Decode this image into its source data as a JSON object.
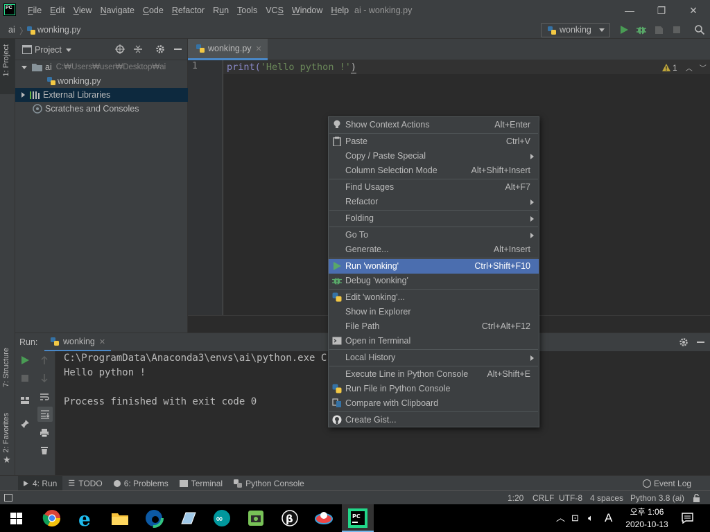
{
  "window": {
    "title": "ai - wonking.py",
    "logo_text": "PC",
    "menu": [
      {
        "label": "File",
        "u": "F"
      },
      {
        "label": "Edit",
        "u": "E"
      },
      {
        "label": "View",
        "u": "V"
      },
      {
        "label": "Navigate",
        "u": "N"
      },
      {
        "label": "Code",
        "u": "C"
      },
      {
        "label": "Refactor",
        "u": "R"
      },
      {
        "label": "Run",
        "u": "u"
      },
      {
        "label": "Tools",
        "u": "T"
      },
      {
        "label": "VCS",
        "u": "S"
      },
      {
        "label": "Window",
        "u": "W"
      },
      {
        "label": "Help",
        "u": "H"
      }
    ],
    "minimize": "—",
    "restore": "❐",
    "close": "✕"
  },
  "navbar": {
    "project": "ai",
    "separator": "〉",
    "file": "wonking.py",
    "run_config": "wonking"
  },
  "left_strip": {
    "project_tab": "1: Project",
    "structure_tab": "7: Structure",
    "favorites_tab": "2: Favorites"
  },
  "project_panel": {
    "title": "Project",
    "tree": {
      "root_name": "ai",
      "root_path": "C:₩Users₩user₩Desktop₩ai",
      "file": "wonking.py",
      "ext_libs": "External Libraries",
      "scratches": "Scratches and Consoles"
    }
  },
  "editor": {
    "tab": "wonking.py",
    "line_number": "1",
    "code_func": "print(",
    "code_string": "'Hello python !'",
    "code_close": ")",
    "inspection_count": "1"
  },
  "run_panel": {
    "label": "Run:",
    "tab": "wonking",
    "console": [
      "C:\\ProgramData\\Anaconda3\\envs\\ai\\python.exe C:/U",
      "Hello python !",
      "",
      "Process finished with exit code 0"
    ]
  },
  "bottom_tabs": [
    {
      "label": "4: Run",
      "icon": "run-icon"
    },
    {
      "label": "TODO",
      "icon": "list-icon"
    },
    {
      "label": "6: Problems",
      "icon": "problems-icon"
    },
    {
      "label": "Terminal",
      "icon": "terminal-icon"
    },
    {
      "label": "Python Console",
      "icon": "python-icon"
    }
  ],
  "event_log": "Event Log",
  "status": {
    "position": "1:20",
    "line_sep": "CRLF",
    "encoding": "UTF-8",
    "indent": "4 spaces",
    "interpreter": "Python 3.8 (ai)"
  },
  "taskbar": {
    "ime": "A",
    "time": "오후 1:06",
    "date": "2020-10-13"
  },
  "context_menu": {
    "items": [
      {
        "label": "Show Context Actions",
        "shortcut": "Alt+Enter",
        "icon": "bulb"
      },
      {
        "label": "Paste",
        "shortcut": "Ctrl+V",
        "icon": "clipboard"
      },
      {
        "label": "Copy / Paste Special",
        "shortcut": "",
        "submenu": true
      },
      {
        "label": "Column Selection Mode",
        "shortcut": "Alt+Shift+Insert"
      },
      {
        "label": "Find Usages",
        "shortcut": "Alt+F7"
      },
      {
        "label": "Refactor",
        "shortcut": "",
        "submenu": true
      },
      {
        "label": "Folding",
        "shortcut": "",
        "submenu": true
      },
      {
        "label": "Go To",
        "shortcut": "",
        "submenu": true
      },
      {
        "label": "Generate...",
        "shortcut": "Alt+Insert"
      },
      {
        "label": "Run 'wonking'",
        "shortcut": "Ctrl+Shift+F10",
        "icon": "run",
        "selected": true
      },
      {
        "label": "Debug 'wonking'",
        "shortcut": "",
        "icon": "debug"
      },
      {
        "label": "Edit 'wonking'...",
        "shortcut": "",
        "icon": "python"
      },
      {
        "label": "Show in Explorer",
        "shortcut": ""
      },
      {
        "label": "File Path",
        "shortcut": "Ctrl+Alt+F12"
      },
      {
        "label": "Open in Terminal",
        "shortcut": "",
        "icon": "terminal"
      },
      {
        "label": "Local History",
        "shortcut": "",
        "submenu": true
      },
      {
        "label": "Execute Line in Python Console",
        "shortcut": "Alt+Shift+E"
      },
      {
        "label": "Run File in Python Console",
        "shortcut": "",
        "icon": "python"
      },
      {
        "label": "Compare with Clipboard",
        "shortcut": "",
        "icon": "compare"
      },
      {
        "label": "Create Gist...",
        "shortcut": "",
        "icon": "github"
      }
    ]
  },
  "colors": {
    "accent": "#4b6eaf",
    "run_green": "#499c54",
    "debug_green": "#59a869",
    "string": "#6a8759",
    "keyword": "#8888c6"
  }
}
